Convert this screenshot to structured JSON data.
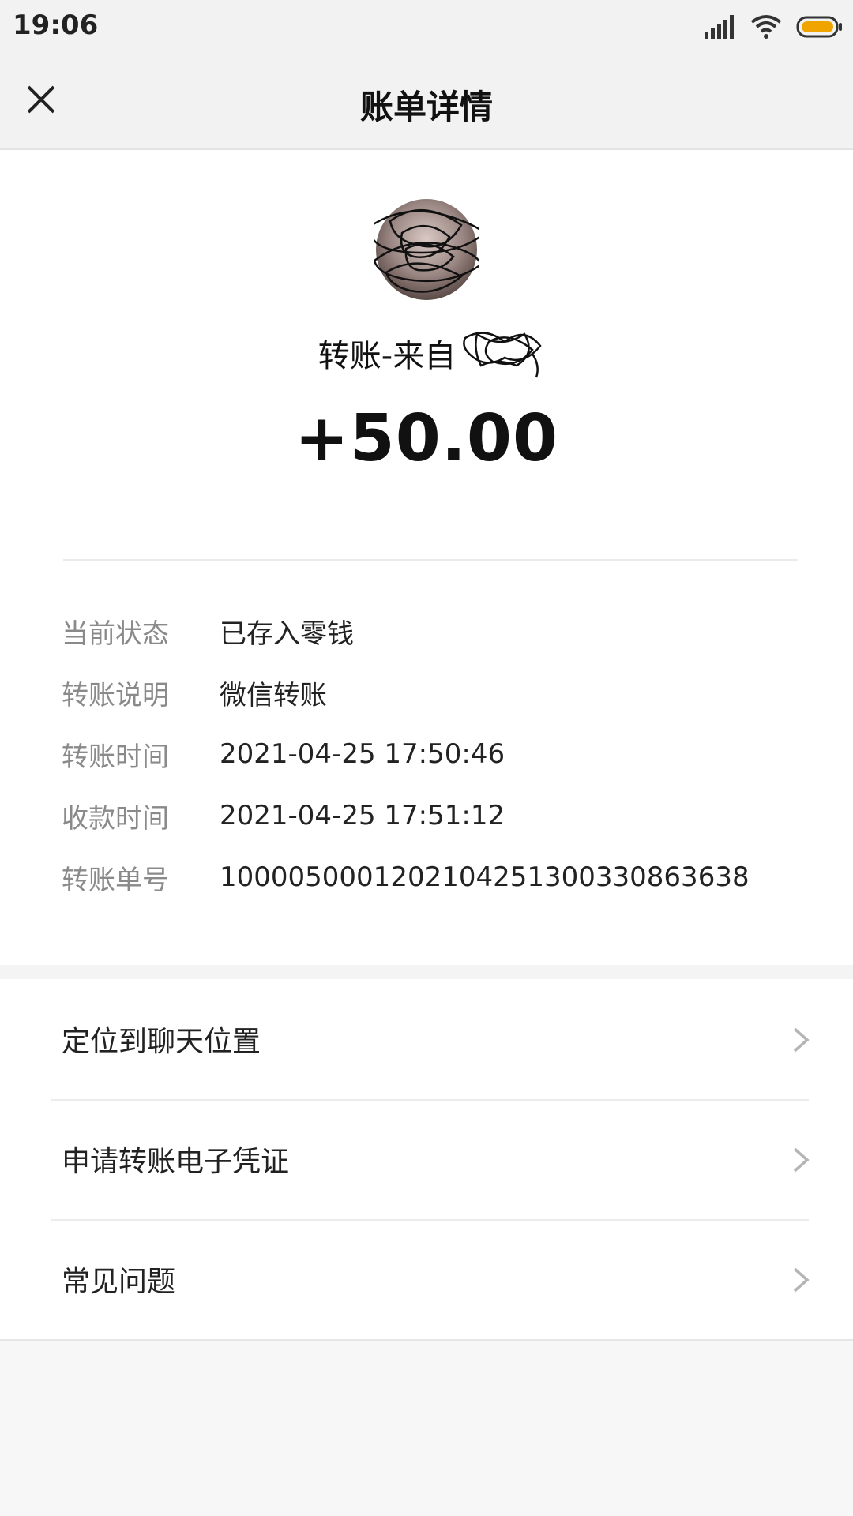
{
  "status_bar": {
    "time": "19:06",
    "icons": [
      "signal-icon",
      "wifi-icon",
      "battery-icon"
    ],
    "battery_color": "#f0a400"
  },
  "header": {
    "title": "账单详情",
    "close_icon": "close-icon"
  },
  "transfer": {
    "from_label": "转账-来自",
    "amount": "+50.00"
  },
  "details": [
    {
      "label": "当前状态",
      "value": "已存入零钱"
    },
    {
      "label": "转账说明",
      "value": "微信转账"
    },
    {
      "label": "转账时间",
      "value": "2021-04-25 17:50:46"
    },
    {
      "label": "收款时间",
      "value": "2021-04-25 17:51:12"
    },
    {
      "label": "转账单号",
      "value": "1000050001202104251300330863638"
    }
  ],
  "actions": [
    {
      "label": "定位到聊天位置",
      "icon": "chevron-right-icon"
    },
    {
      "label": "申请转账电子凭证",
      "icon": "chevron-right-icon"
    },
    {
      "label": "常见问题",
      "icon": "chevron-right-icon"
    }
  ],
  "colors": {
    "label_gray": "#8a8a8a",
    "background": "#f7f7f7",
    "card": "#ffffff"
  }
}
